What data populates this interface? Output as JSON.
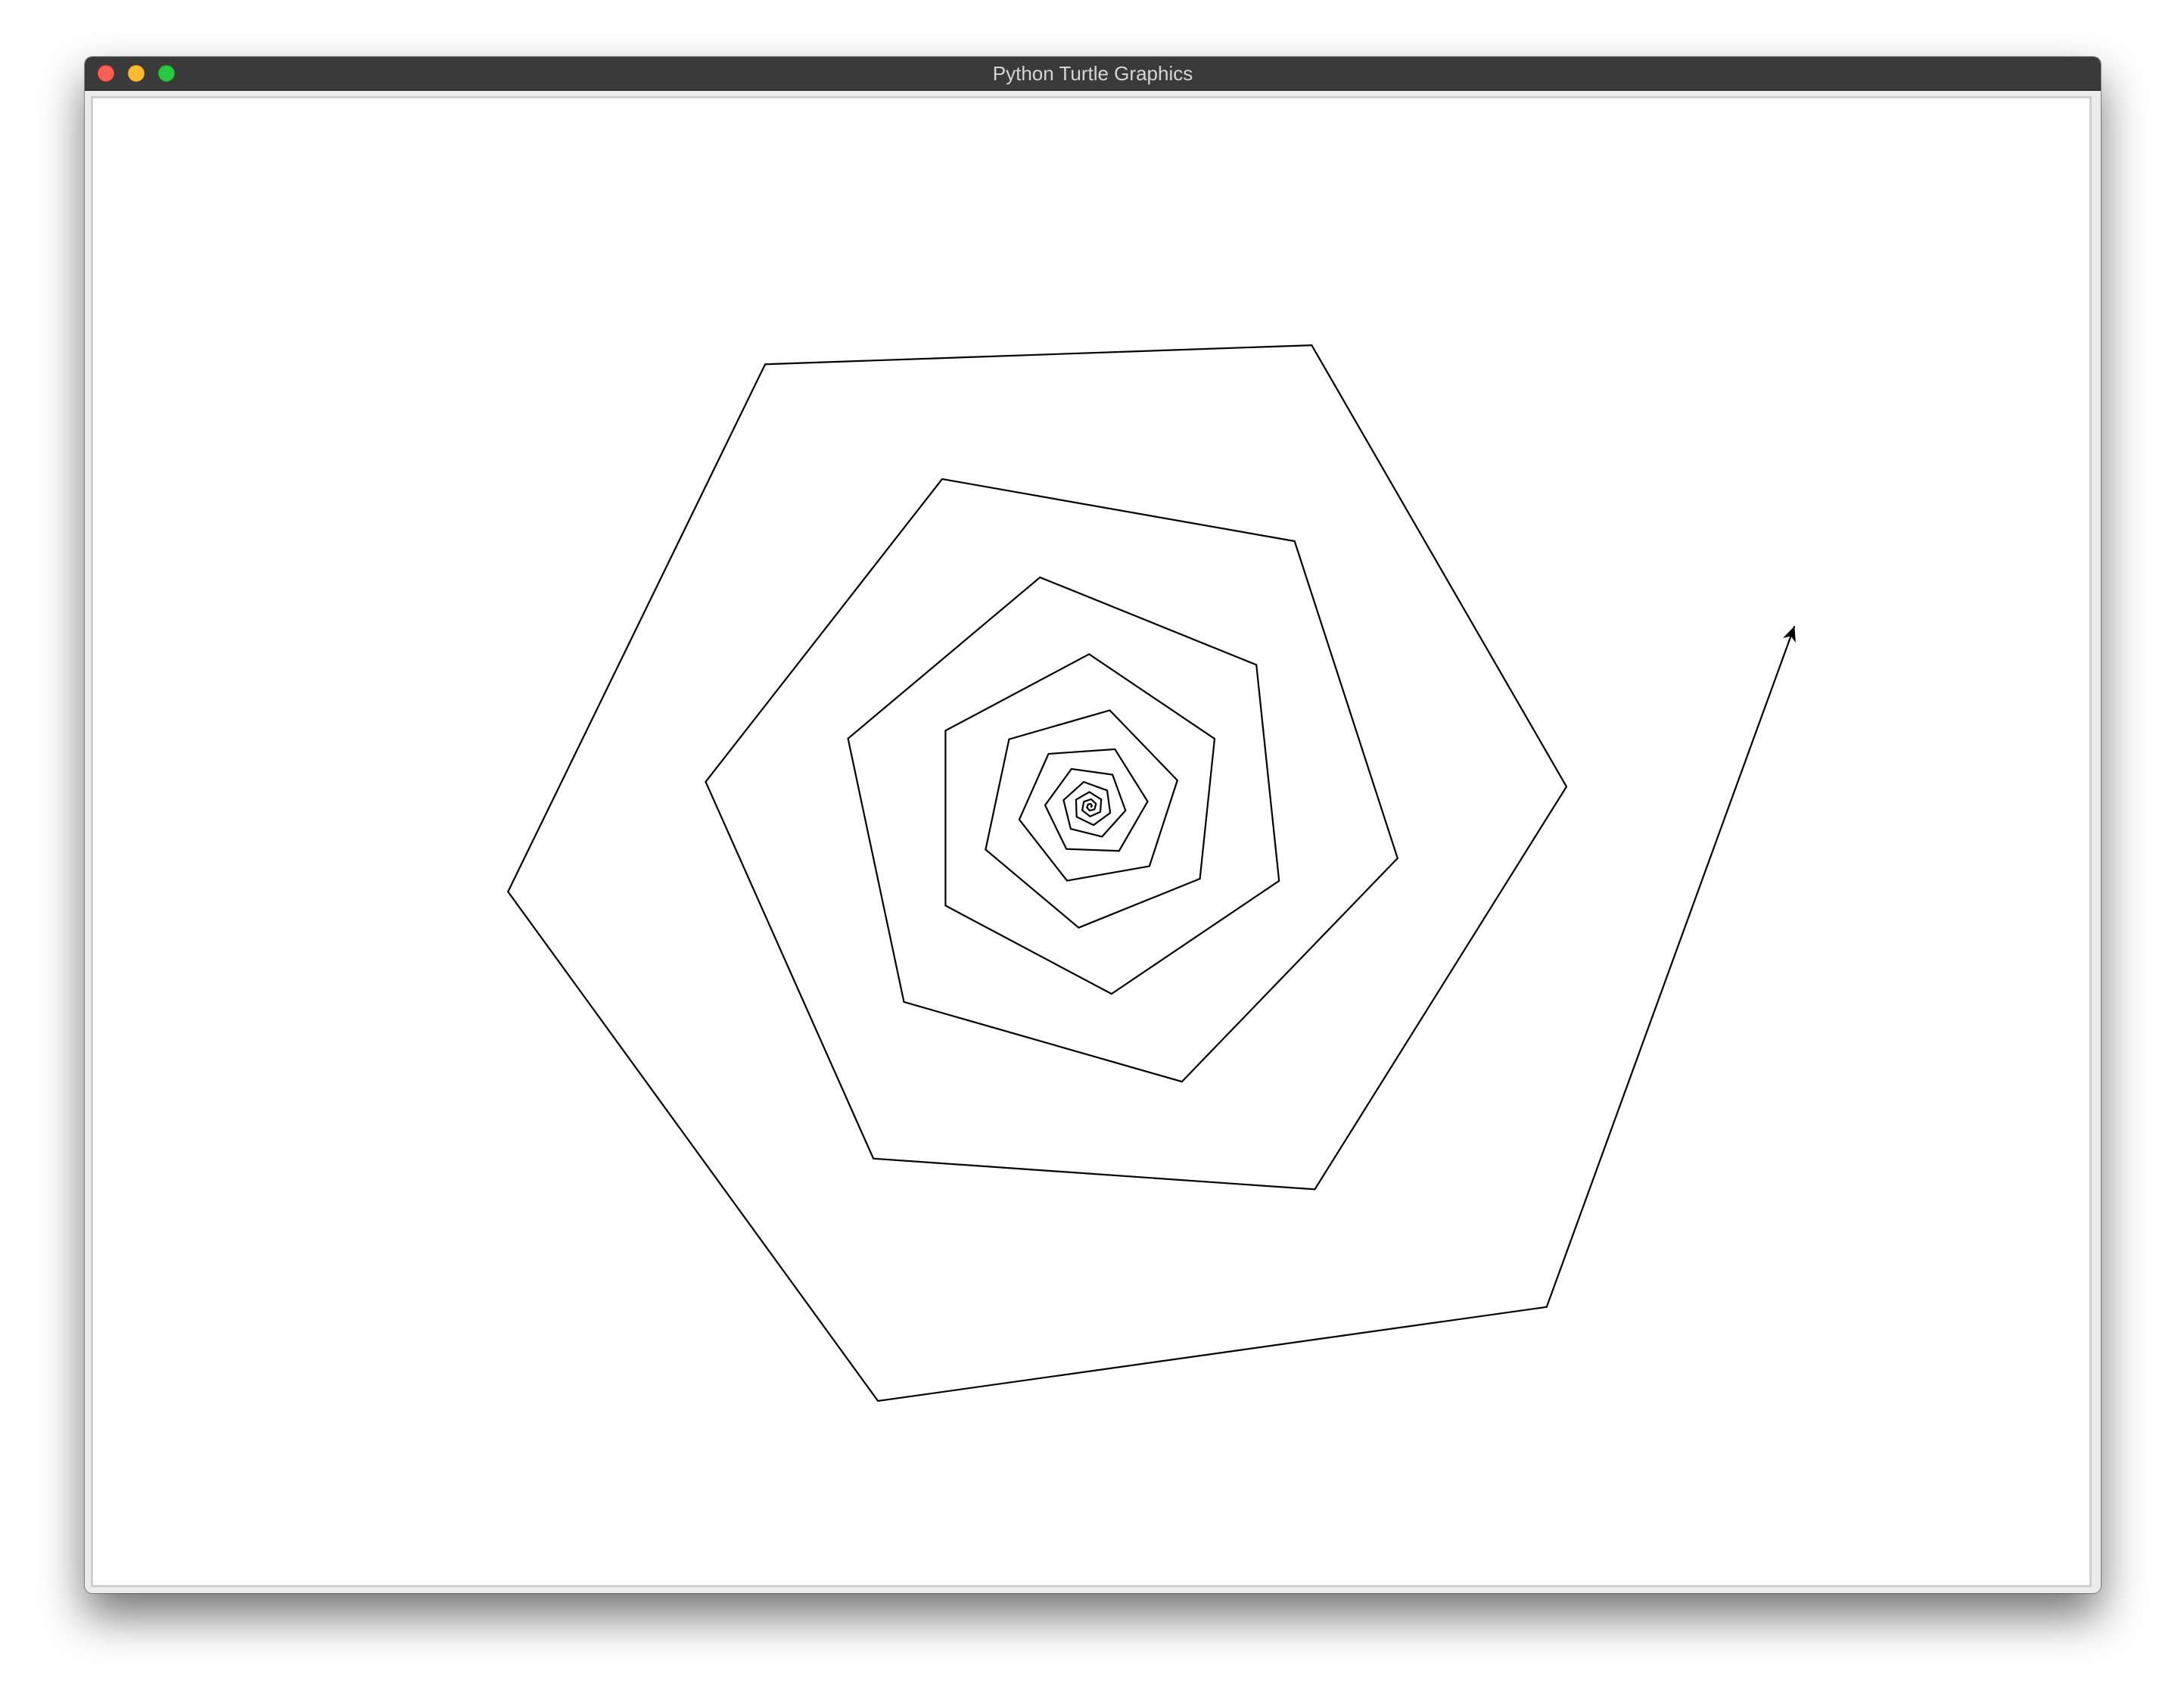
{
  "window": {
    "title": "Python Turtle Graphics"
  },
  "canvas": {
    "background_color": "#ffffff",
    "pen_color": "#000000",
    "drawing": "spiral",
    "turtle_icon": "arrow-icon"
  }
}
